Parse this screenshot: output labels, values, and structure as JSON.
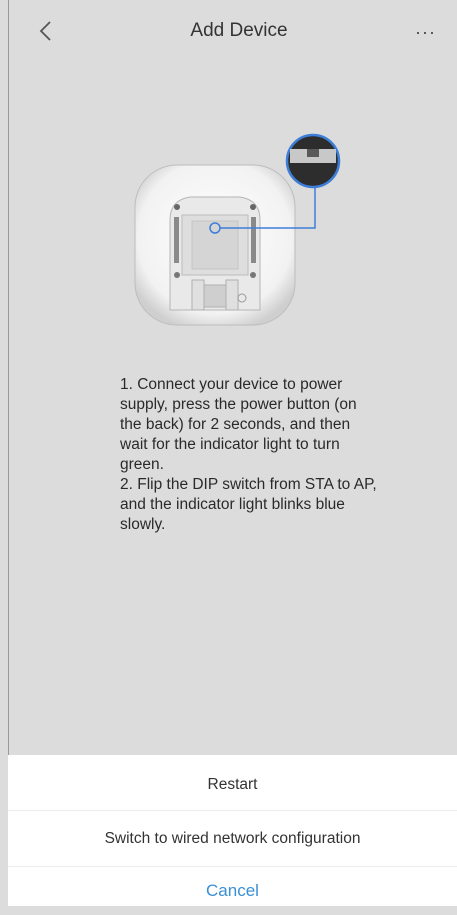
{
  "header": {
    "title": "Add Device",
    "back_icon": "chevron-left-icon",
    "more_icon": "more-horizontal-icon",
    "more_glyph": "···"
  },
  "illustration": {
    "description_icon": "hub-device-back-panel",
    "accent_color": "#3d7fd8"
  },
  "instructions": {
    "step1": "1. Connect your device to power supply, press the power button (on the back) for 2 seconds, and then wait for the indicator light to turn green.",
    "step2": "2. Flip the DIP switch from STA to AP, and the indicator light blinks blue slowly."
  },
  "action_sheet": {
    "restart_label": "Restart",
    "wired_label": "Switch to wired network configuration",
    "cancel_label": "Cancel",
    "cancel_color": "#3b8fd4"
  }
}
